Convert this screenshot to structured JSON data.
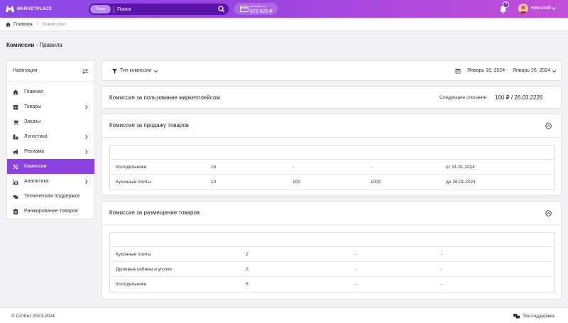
{
  "header": {
    "logo_text": "MARKETPLACE",
    "search_scope": "Товар",
    "search_placeholder": "Поиск",
    "account_label": "Личный счет",
    "account_balance": "673 629 ₽",
    "notifications_count": "0",
    "user_name": "Николай"
  },
  "breadcrumb": {
    "home": "Главная",
    "separator": "/",
    "current": "Комиссии"
  },
  "page_title": {
    "bold": "Комиссии",
    "rest": " - Правила"
  },
  "sidebar": {
    "title": "Навигация",
    "items": [
      {
        "label": "Главная",
        "icon": "home-icon",
        "has_children": false,
        "active": false
      },
      {
        "label": "Товары",
        "icon": "box-icon",
        "has_children": true,
        "active": false
      },
      {
        "label": "Заказы",
        "icon": "cart-icon",
        "has_children": false,
        "active": false
      },
      {
        "label": "Логистика",
        "icon": "warehouse-icon",
        "has_children": true,
        "active": false
      },
      {
        "label": "Реклама",
        "icon": "megaphone-icon",
        "has_children": true,
        "active": false
      },
      {
        "label": "Комиссии",
        "icon": "percent-icon",
        "has_children": false,
        "active": true
      },
      {
        "label": "Аналитика",
        "icon": "chart-icon",
        "has_children": true,
        "active": false
      },
      {
        "label": "Техническая поддержка",
        "icon": "support-icon",
        "has_children": false,
        "active": false
      },
      {
        "label": "Ранжирование товаров",
        "icon": "clipboard-icon",
        "has_children": false,
        "active": false
      }
    ]
  },
  "filters": {
    "commission_type_label": "Тип комиссии",
    "date_from": "Январь 18, 2024",
    "date_separator": "-",
    "date_to": "Январь 26, 2024"
  },
  "marketplace_commission": {
    "title": "Комиссия за пользование маркетплейсом",
    "next_charge_label": "Следующее списание:",
    "next_charge_value": "100 ₽ / 26.03.2226"
  },
  "sales_commission": {
    "title": "Комиссия за продажу товаров",
    "rows": [
      [
        "Холодильники",
        "15",
        "-",
        "-",
        "от 31.01.2024"
      ],
      [
        "Кухонные плиты",
        "10",
        "100",
        "1000",
        "до 28.01.2024"
      ]
    ]
  },
  "placement_commission": {
    "title": "Комиссия за размещение товаров",
    "rows": [
      [
        "Кухонные плиты",
        "2",
        "-",
        "-"
      ],
      [
        "Душевые кабины и уголки",
        "2",
        "-",
        "-"
      ],
      [
        "Холодильники",
        "5",
        "-",
        "-"
      ]
    ]
  },
  "footer": {
    "copyright": "© Сотбит 2013-2024",
    "support_label": "Тех.поддержка"
  }
}
